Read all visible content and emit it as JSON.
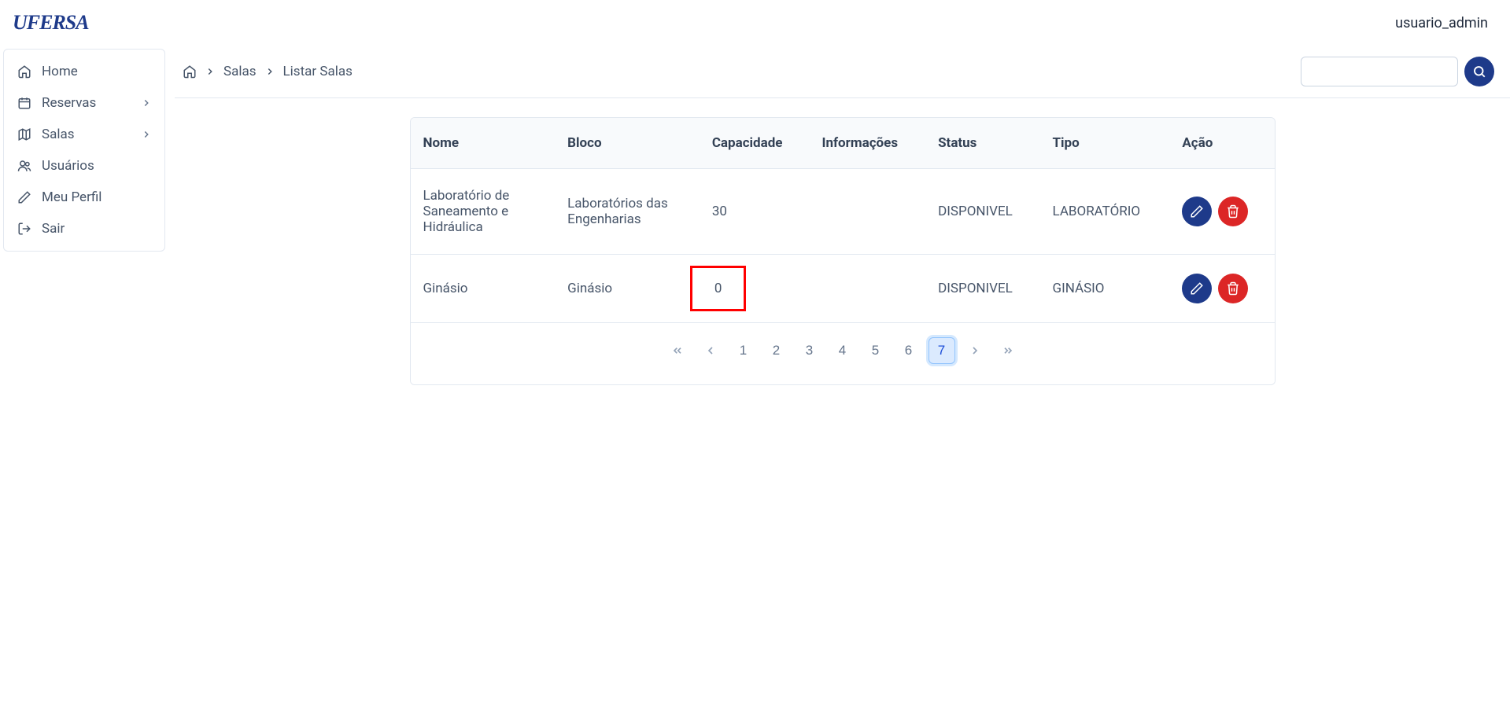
{
  "header": {
    "logo": "UFERSA",
    "username": "usuario_admin"
  },
  "sidebar": {
    "items": [
      {
        "icon": "home",
        "label": "Home",
        "expandable": false
      },
      {
        "icon": "calendar",
        "label": "Reservas",
        "expandable": true
      },
      {
        "icon": "map",
        "label": "Salas",
        "expandable": true
      },
      {
        "icon": "users",
        "label": "Usuários",
        "expandable": false
      },
      {
        "icon": "pencil",
        "label": "Meu Perfil",
        "expandable": false
      },
      {
        "icon": "logout",
        "label": "Sair",
        "expandable": false
      }
    ]
  },
  "breadcrumb": {
    "items": [
      "Salas",
      "Listar Salas"
    ]
  },
  "search": {
    "value": ""
  },
  "table": {
    "headers": [
      "Nome",
      "Bloco",
      "Capacidade",
      "Informações",
      "Status",
      "Tipo",
      "Ação"
    ],
    "rows": [
      {
        "nome": "Laboratório de Saneamento e Hidráulica",
        "bloco": "Laboratórios das Engenharias",
        "capacidade": "30",
        "informacoes": "",
        "status": "DISPONIVEL",
        "tipo": "LABORATÓRIO",
        "highlight_capacidade": false
      },
      {
        "nome": "Ginásio",
        "bloco": "Ginásio",
        "capacidade": "0",
        "informacoes": "",
        "status": "DISPONIVEL",
        "tipo": "GINÁSIO",
        "highlight_capacidade": true
      }
    ]
  },
  "pagination": {
    "pages": [
      "1",
      "2",
      "3",
      "4",
      "5",
      "6",
      "7"
    ],
    "current": "7"
  }
}
